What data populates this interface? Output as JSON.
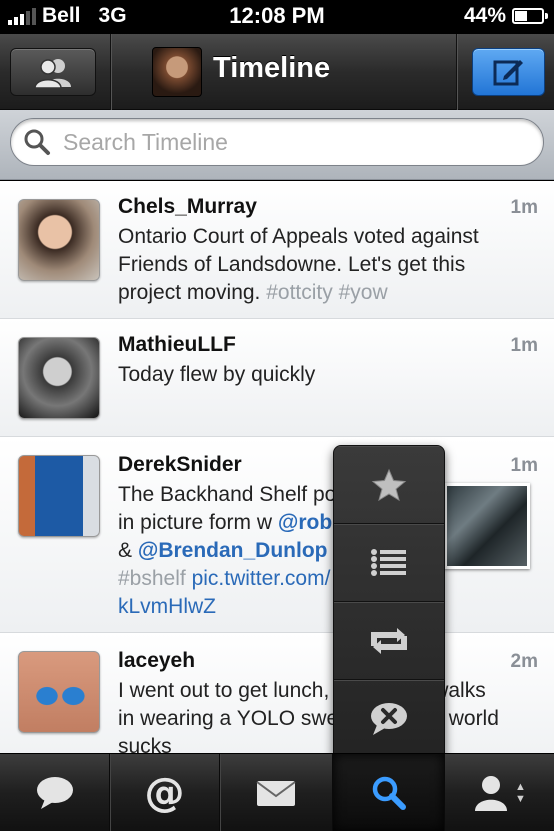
{
  "status_bar": {
    "carrier": "Bell",
    "network": "3G",
    "time": "12:08 PM",
    "battery": "44%"
  },
  "nav": {
    "title": "Timeline",
    "left_icon": "accounts-icon",
    "right_icon": "compose-icon"
  },
  "search": {
    "placeholder": "Search Timeline"
  },
  "tweets": [
    {
      "name": "Chels_Murray",
      "time": "1m",
      "text_lines": [
        "Ontario Court of Appeals voted against",
        "Friends of Landsdowne. Let's get this",
        "project moving. "
      ],
      "tags": [
        "#ottcity",
        "#yow"
      ]
    },
    {
      "name": "MathieuLLF",
      "time": "1m",
      "text_lines": [
        "Today flew by quickly"
      ]
    },
    {
      "name": "DerekSnider",
      "time": "1m",
      "text_lines": [
        "The Backhand Shelf podcast",
        "in picture form w ",
        "& "
      ],
      "mentions": [
        "@robpizzo",
        "@Brendan_Dunlop"
      ],
      "tag": "#bshelf",
      "link_lines": [
        "pic.twitter.com/",
        "kLvmHlwZ"
      ]
    },
    {
      "name": "laceyeh",
      "time": "2m",
      "text_lines": [
        "I went out to get lunch, and a guy walks",
        "in wearing a YOLO sweatshirt. The world",
        "sucks"
      ]
    }
  ],
  "popover": {
    "items": [
      "favorite-icon",
      "list-icon",
      "retweet-icon",
      "reply-icon"
    ]
  },
  "tabbar": {
    "mentions_label": "@",
    "tabs": [
      "timeline",
      "mentions",
      "messages",
      "search",
      "account"
    ],
    "active": "search"
  },
  "colors": {
    "accent": "#2a6ab8",
    "compose": "#2f86e0",
    "tag": "#9aa0a6"
  }
}
